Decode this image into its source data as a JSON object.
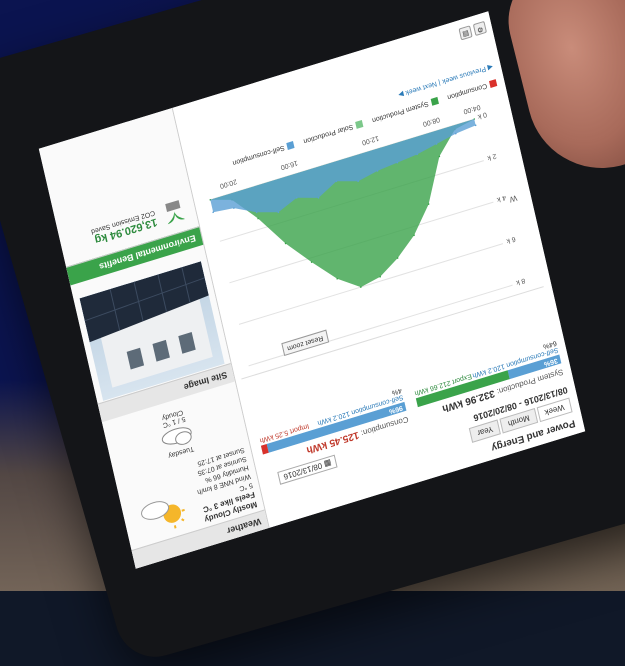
{
  "power_energy": {
    "title": "Power and Energy",
    "tabs": [
      "Week",
      "Month",
      "Year"
    ],
    "date_range": "08/13/2016 - 08/20/2016",
    "date_picker": "08/13/2016",
    "system_production": {
      "label": "System Production:",
      "value": "332.96 kWh",
      "self_consumption_pct": "36%",
      "self_consumption_pct_value": 36,
      "export_pct": "64%",
      "export_pct_value": 64,
      "self_consumption_label": "Self-consumption",
      "self_consumption_value": "120.2 kWh",
      "export_label": "Export",
      "export_value": "212.66 kWh"
    },
    "consumption": {
      "label": "Consumption:",
      "value": "125.45 kWh",
      "self_consumption_pct": "96%",
      "self_consumption_pct_value": 96,
      "import_pct": "4%",
      "import_pct_value": 4,
      "self_consumption_label": "Self-consumption",
      "self_consumption_value": "120.2 kWh",
      "import_label": "Import",
      "import_value": "5.25 kWh"
    },
    "reset_zoom": "Reset zoom",
    "legend": {
      "consumption": "Consumption",
      "system_production": "System Production",
      "solar_production": "Solar Production",
      "self_consumption": "Self-consumption"
    },
    "week_nav": {
      "previous": "◀ Previous week",
      "separator": "|",
      "next": "Next week ▶"
    },
    "colors": {
      "consumption": "#d9312b",
      "production": "#3aa34a",
      "self": "#5a9fd4",
      "self_fill": "#4a8fbf"
    }
  },
  "chart_data": {
    "type": "area",
    "ylabel": "W",
    "y_ticks": [
      "0 k",
      "2 k",
      "4 k",
      "6 k",
      "8 k"
    ],
    "ylim": [
      0,
      8000
    ],
    "x_ticks": [
      "04:00",
      "08:00",
      "12:00",
      "16:00",
      "20:00"
    ],
    "x": [
      "04:00",
      "06:00",
      "08:00",
      "10:00",
      "11:00",
      "12:00",
      "13:00",
      "14:00",
      "15:00",
      "16:00",
      "17:00",
      "18:00",
      "20:00",
      "22:00"
    ],
    "series": [
      {
        "name": "Solar Production",
        "values": [
          0,
          200,
          1200,
          3200,
          4400,
          5200,
          5800,
          6000,
          5300,
          4200,
          3000,
          1500,
          300,
          0
        ]
      },
      {
        "name": "Self-consumption",
        "values": [
          300,
          400,
          600,
          800,
          900,
          1000,
          1200,
          900,
          1400,
          1100,
          1500,
          1200,
          700,
          600
        ]
      }
    ],
    "grid": true
  },
  "weather": {
    "title": "Weather",
    "now": {
      "condition": "Mostly Cloudy",
      "feels_like": "Feels like 3 °C",
      "temp": "5 °C",
      "wind": "Wind NNE 8 km/h",
      "humidity": "Humidity 66 %",
      "sunrise": "Sunrise at 07:35",
      "sunset": "Sunset at 17:25"
    },
    "tomorrow": {
      "day": "Tuesday",
      "temp": "5 / 1 °C",
      "condition": "Cloudy"
    }
  },
  "site_image": {
    "title": "Site Image"
  },
  "environment": {
    "title": "Environmental Benefits",
    "co2_value": "13,620.94 kg",
    "co2_label": "CO2 Emission Saved"
  }
}
